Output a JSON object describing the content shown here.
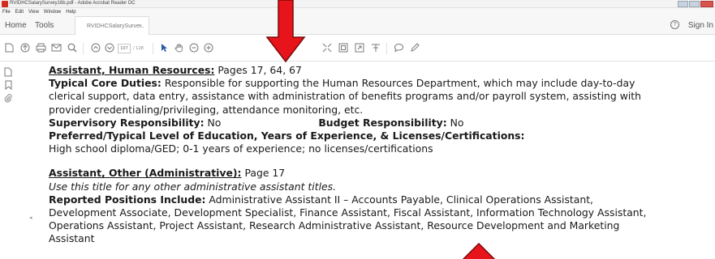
{
  "window": {
    "title": "RVIDHCSalarySurvey16b.pdf - Adobe Acrobat Reader DC",
    "menu": [
      "File",
      "Edit",
      "View",
      "Window",
      "Help"
    ]
  },
  "tabs": {
    "home": "Home",
    "tools": "Tools",
    "document": "RVIDHCSalarySurve...",
    "close": "×",
    "sign_in": "Sign In",
    "help": "?"
  },
  "toolbar": {
    "page_current": "107",
    "page_total": "/ 128",
    "icons": [
      "create-pdf-icon",
      "upload-icon",
      "print-icon",
      "email-icon",
      "search-icon",
      "previous-page-icon",
      "next-page-icon",
      "select-cursor-icon",
      "hand-tool-icon",
      "zoom-out-icon",
      "zoom-in-icon",
      "fit-page-icon",
      "full-screen-icon",
      "read-mode-icon",
      "form-tool-icon",
      "comment-icon",
      "sign-icon"
    ]
  },
  "left_pane": {
    "icons": [
      "page-thumbnails-icon",
      "bookmark-icon",
      "attachment-icon"
    ]
  },
  "document": {
    "entry1": {
      "title": "Assistant, Human Resources:",
      "pages": " Pages 17, 64, 67",
      "duties_label": "Typical Core Duties:",
      "duties_line1": " Responsible for supporting the Human Resources Department, which may include day-to-day",
      "duties_line2": "clerical support, data entry, assistance with administration of benefits programs and/or payroll system, assisting with",
      "duties_line3": "provider credentialing/privileging, attendance monitoring, etc.",
      "supervisory_label": "Supervisory Responsibility:",
      "supervisory_value": " No",
      "budget_label": "Budget Responsibility:",
      "budget_value": " No",
      "education_label": "Preferred/Typical Level of Education, Years of Experience, & Licenses/Certifications:",
      "education_value": "High school diploma/GED; 0-1 years of experience; no licenses/certifications"
    },
    "entry2": {
      "title": "Assistant, Other (Administrative):",
      "pages": " Page 17",
      "note": "Use this title for any other administrative assistant titles.",
      "reported_label": "Reported Positions Include:",
      "reported_line1": " Administrative Assistant II – Accounts Payable, Clinical Operations Assistant,",
      "reported_line2": "Development Associate, Development Specialist, Finance Assistant, Fiscal Assistant, Information Technology Assistant,",
      "reported_line3": "Operations Assistant, Project Assistant, Research Administrative Assistant, Resource Development and Marketing",
      "reported_line4": "Assistant"
    }
  },
  "colors": {
    "arrow_red": "#e8141b",
    "arrow_outline": "#7a0a0a"
  }
}
